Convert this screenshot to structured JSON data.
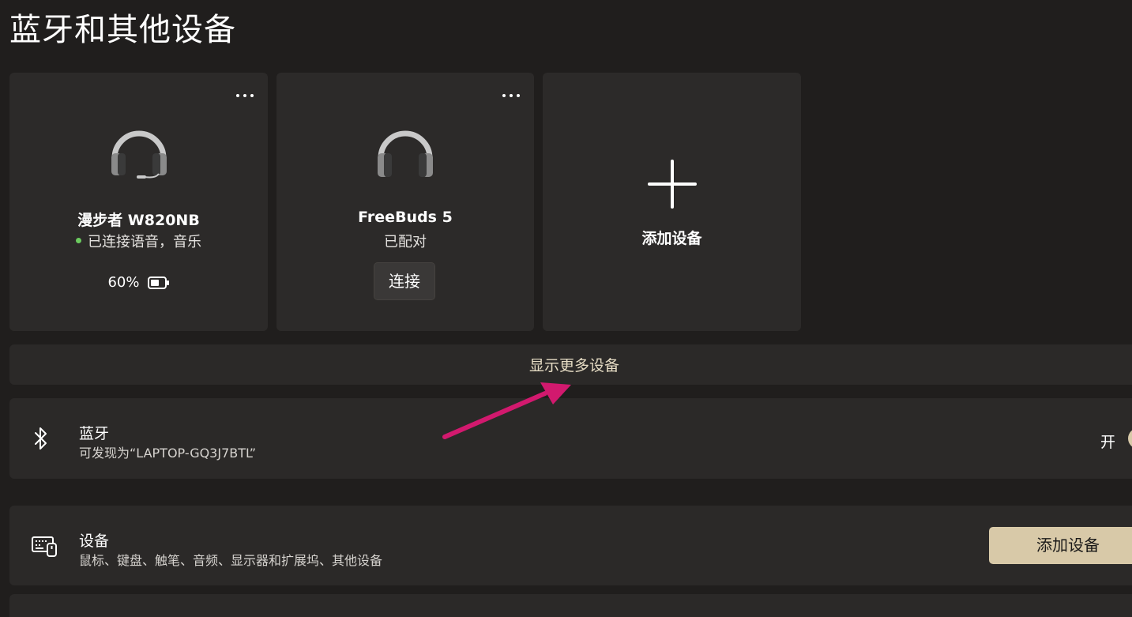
{
  "page": {
    "title": "蓝牙和其他设备"
  },
  "devices": [
    {
      "name": "漫步者 W820NB",
      "status": "已连接语音，音乐",
      "battery": "60%",
      "icon": "headset-icon",
      "status_color": "#6ccb5f"
    },
    {
      "name": "FreeBuds 5",
      "status": "已配对",
      "action_label": "连接",
      "icon": "headphones-icon"
    }
  ],
  "add_card": {
    "label": "添加设备",
    "icon": "plus-icon"
  },
  "show_more": {
    "label": "显示更多设备"
  },
  "bluetooth": {
    "title": "蓝牙",
    "subtitle": "可发现为“LAPTOP-GQ3J7BTL”",
    "toggle_label": "开",
    "icon": "bluetooth-icon"
  },
  "devices_row": {
    "title": "设备",
    "subtitle": "鼠标、键盘、触笔、音频、显示器和扩展坞、其他设备",
    "button_label": "添加设备",
    "icon": "keyboard-mouse-icon"
  },
  "colors": {
    "background": "#201e1d",
    "card": "#2c2a29",
    "accent": "#d8c9a8",
    "annotation_arrow": "#d2196e"
  }
}
